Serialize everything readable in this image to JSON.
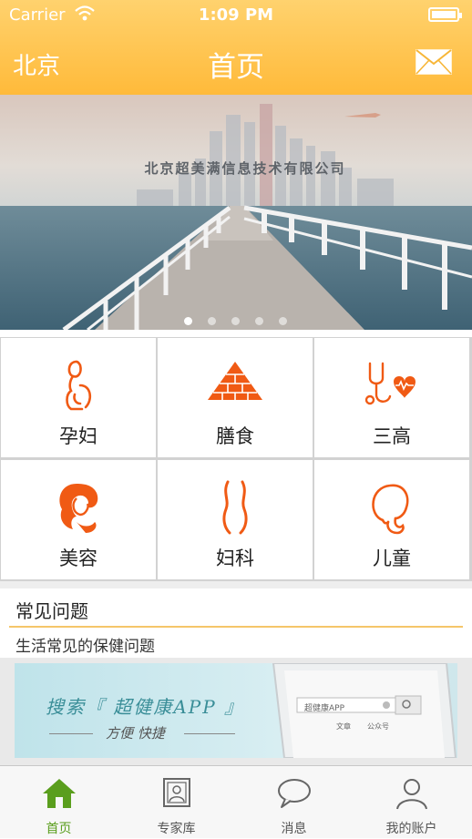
{
  "status_bar": {
    "carrier": "Carrier",
    "time": "1:09 PM"
  },
  "nav": {
    "city": "北京",
    "title": "首页",
    "icon": "mail-icon"
  },
  "banner": {
    "caption": "北京超美满信息技术有限公司",
    "page_count": 5,
    "active_index": 0
  },
  "categories": [
    {
      "label": "孕妇",
      "icon": "pregnant-woman-icon"
    },
    {
      "label": "膳食",
      "icon": "food-pyramid-icon"
    },
    {
      "label": "三高",
      "icon": "stethoscope-heart-icon"
    },
    {
      "label": "美容",
      "icon": "woman-face-icon"
    },
    {
      "label": "妇科",
      "icon": "female-body-icon"
    },
    {
      "label": "儿童",
      "icon": "child-head-icon"
    }
  ],
  "faq": {
    "title": "常见问题",
    "subtitle": "生活常见的保健问题",
    "ad": {
      "title": "搜索『 超健康APP 』",
      "tagline": "方便  快捷",
      "search_text": "超健康APP",
      "options": [
        "文章",
        "公众号"
      ]
    }
  },
  "tabbar": [
    {
      "label": "首页",
      "icon": "home-icon",
      "active": true
    },
    {
      "label": "专家库",
      "icon": "expert-icon",
      "active": false
    },
    {
      "label": "消息",
      "icon": "message-icon",
      "active": false
    },
    {
      "label": "我的账户",
      "icon": "user-icon",
      "active": false
    }
  ],
  "colors": {
    "header": "#ffba3a",
    "accent_orange": "#f05a14",
    "tab_active": "#5a9e1d"
  }
}
